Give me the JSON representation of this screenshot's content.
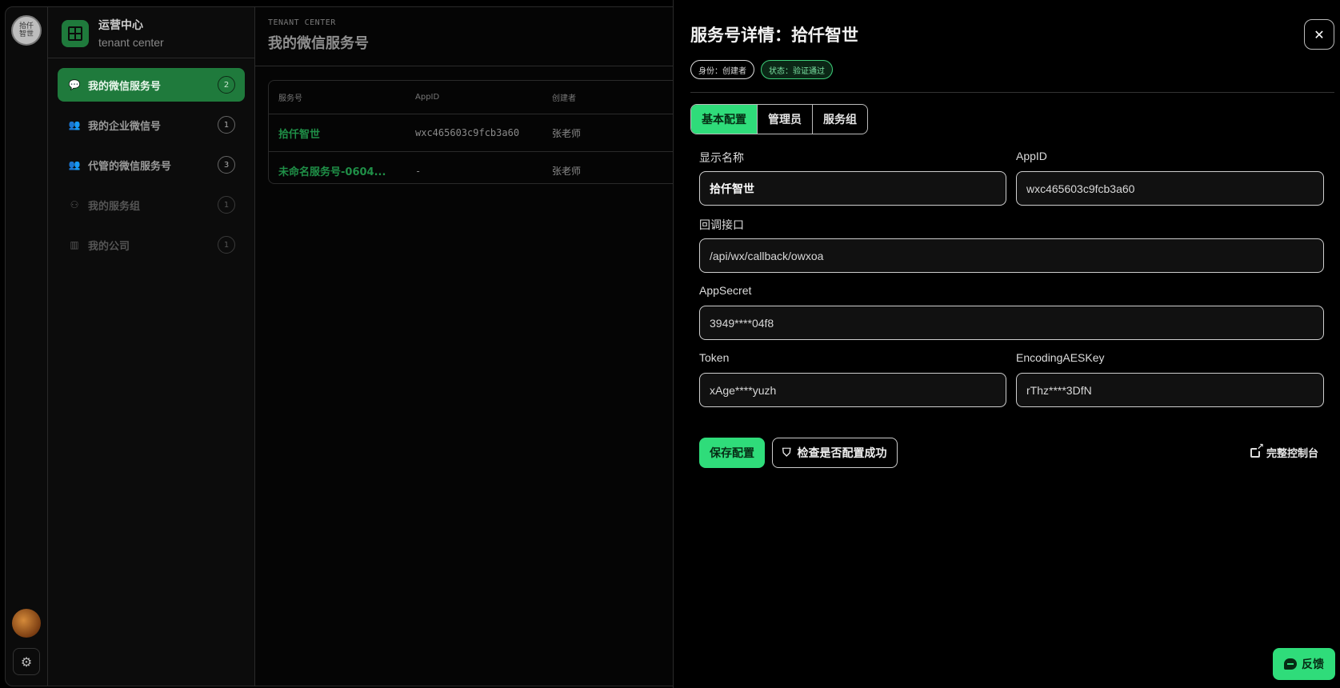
{
  "rail": {
    "logo_text": "拾仟智世",
    "avatar_alt": "user avatar",
    "settings_icon": "gear-icon"
  },
  "sidebar": {
    "brand_title": "运营中心",
    "brand_sub": "tenant center",
    "items": [
      {
        "label": "我的微信服务号",
        "badge": "2",
        "icon": "wechat-icon",
        "active": true
      },
      {
        "label": "我的企业微信号",
        "badge": "1",
        "icon": "users-icon"
      },
      {
        "label": "代管的微信服务号",
        "badge": "3",
        "icon": "users-icon"
      },
      {
        "label": "我的服务组",
        "badge": "1",
        "icon": "group-icon",
        "dim": true
      },
      {
        "label": "我的公司",
        "badge": "1",
        "icon": "building-icon",
        "dim": true
      }
    ]
  },
  "main": {
    "kicker": "TENANT CENTER",
    "title": "我的微信服务号",
    "table": {
      "headers": [
        "服务号",
        "AppID",
        "创建者"
      ],
      "rows": [
        [
          "拾仟智世",
          "wxc465603c9fcb3a60",
          "张老师"
        ],
        [
          "未命名服务号-0604...",
          "-",
          "张老师"
        ]
      ]
    }
  },
  "drawer": {
    "title": "服务号详情：拾仟智世",
    "chip_role": "身份：创建者",
    "chip_status": "状态：验证通过",
    "tabs": [
      "基本配置",
      "管理员",
      "服务组"
    ],
    "fields": {
      "display_name_label": "显示名称",
      "display_name_value": "拾仟智世",
      "appid_label": "AppID",
      "appid_value": "wxc465603c9fcb3a60",
      "callback_label": "回调接口",
      "callback_value": "/api/wx/callback/owxoa",
      "secret_label": "AppSecret",
      "secret_value": "3949****04f8",
      "token_label": "Token",
      "token_value": "xAge****yuzh",
      "aes_label": "EncodingAESKey",
      "aes_value": "rThz****3DfN"
    },
    "save_label": "保存配置",
    "check_label": "检查是否配置成功",
    "console_label": "完整控制台",
    "close_icon": "close-icon"
  },
  "feedback_label": "反馈",
  "colors": {
    "accent": "#2fdc7a",
    "accent_dark": "#1f7a3c",
    "background": "#000000"
  }
}
